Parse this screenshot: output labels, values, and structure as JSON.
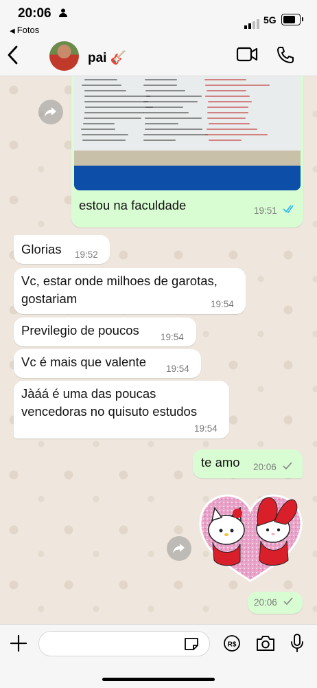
{
  "status_bar": {
    "time": "20:06",
    "back_app": "Fotos",
    "network": "5G"
  },
  "header": {
    "contact_name": "pai 🎸"
  },
  "messages": [
    {
      "dir": "out",
      "type": "image",
      "caption": "estou na faculdade",
      "time": "19:51",
      "status": "read"
    },
    {
      "dir": "in",
      "text": "Glorias",
      "time": "19:52"
    },
    {
      "dir": "in",
      "text": "Vc, estar onde milhoes de garotas, gostariam",
      "line1": "Vc, estar onde milhoes de garotas,",
      "line2": "gostariam",
      "time": "19:54"
    },
    {
      "dir": "in",
      "text": "Previlegio de poucos",
      "time": "19:54"
    },
    {
      "dir": "in",
      "text": "Vc é mais que valente",
      "time": "19:54"
    },
    {
      "dir": "in",
      "text": "Jàáá é uma das poucas vencedoras no quisuto estudos",
      "line1": "Jàáá é uma das poucas",
      "line2": "vencedoras no quisuto estudos",
      "time": "19:54"
    },
    {
      "dir": "out",
      "text": "te amo",
      "time": "20:06",
      "status": "delivered"
    },
    {
      "dir": "out",
      "type": "sticker",
      "sticker_name": "hello-kitty-my-melody-heart",
      "time": "20:06",
      "status": "delivered"
    }
  ],
  "composer": {
    "placeholder": ""
  },
  "colors": {
    "outgoing": "#d9fdd3",
    "incoming": "#ffffff",
    "read_tick": "#34b7f1",
    "background": "#efe7de"
  }
}
